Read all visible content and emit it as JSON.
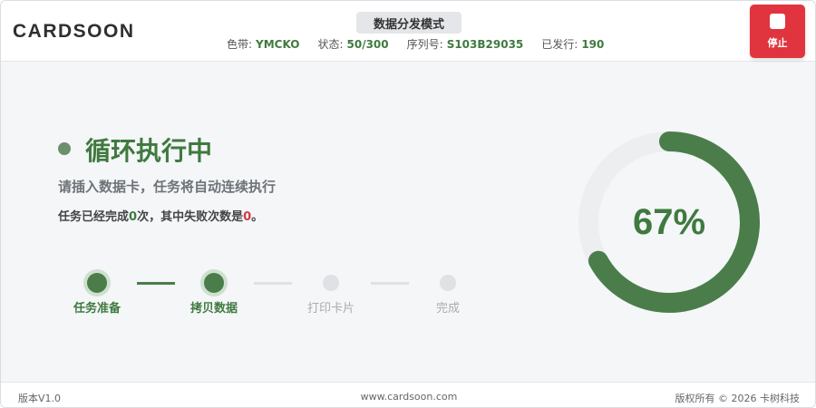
{
  "header": {
    "logo": "CARDSOON",
    "mode": "数据分发模式",
    "ribbon_label": "色带:",
    "ribbon_value": "YMCKO",
    "state_label": "状态:",
    "state_value": "50/300",
    "serial_label": "序列号:",
    "serial_value": "S103B29035",
    "issued_label": "已发行:",
    "issued_value": "190",
    "stop_label": "停止"
  },
  "main": {
    "status_title": "循环执行中",
    "instruction": "请插入数据卡，任务将自动连续执行",
    "progress_prefix": "任务已经完成",
    "completed": "0",
    "progress_mid": "次，其中失败次数是",
    "failed": "0",
    "progress_suffix": "。"
  },
  "steps": [
    {
      "label": "任务准备",
      "state": "done"
    },
    {
      "label": "拷贝数据",
      "state": "done"
    },
    {
      "label": "打印卡片",
      "state": "pending"
    },
    {
      "label": "完成",
      "state": "pending"
    }
  ],
  "progress": {
    "percent": 67,
    "label": "67%",
    "color": "#4a7d4a",
    "track_color": "#eceeef"
  },
  "footer": {
    "version": "版本V1.0",
    "website": "www.cardsoon.com",
    "copyright": "版权所有 © 2026 卡树科技"
  }
}
